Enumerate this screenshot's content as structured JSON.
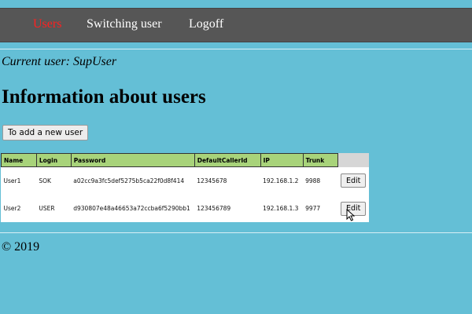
{
  "nav": {
    "items": [
      {
        "label": "Users",
        "active": true
      },
      {
        "label": "Switching user",
        "active": false
      },
      {
        "label": "Logoff",
        "active": false
      }
    ]
  },
  "current_user": "Current user: SupUser",
  "page_title": "Information about users",
  "add_button_label": "To add a new user",
  "table": {
    "columns": [
      "Name",
      "Login",
      "Password",
      "DefaultCallerId",
      "IP",
      "Trunk"
    ],
    "rows": [
      {
        "name": "User1",
        "login": "SOK",
        "password": "a02cc9a3fc5def5275b5ca22f0d8f414",
        "caller_id": "12345678",
        "ip": "192.168.1.2",
        "trunk": "9988",
        "edit_label": "Edit"
      },
      {
        "name": "User2",
        "login": "USER",
        "password": "d930807e48a46653a72ccba6f5290bb1",
        "caller_id": "123456789",
        "ip": "192.168.1.3",
        "trunk": "9977",
        "edit_label": "Edit"
      }
    ]
  },
  "footer": "© 2019",
  "colors": {
    "page_background": "#64bfd6",
    "navbar_background": "#565656",
    "active_nav": "#ff2020",
    "table_header": "#a8d37a"
  }
}
